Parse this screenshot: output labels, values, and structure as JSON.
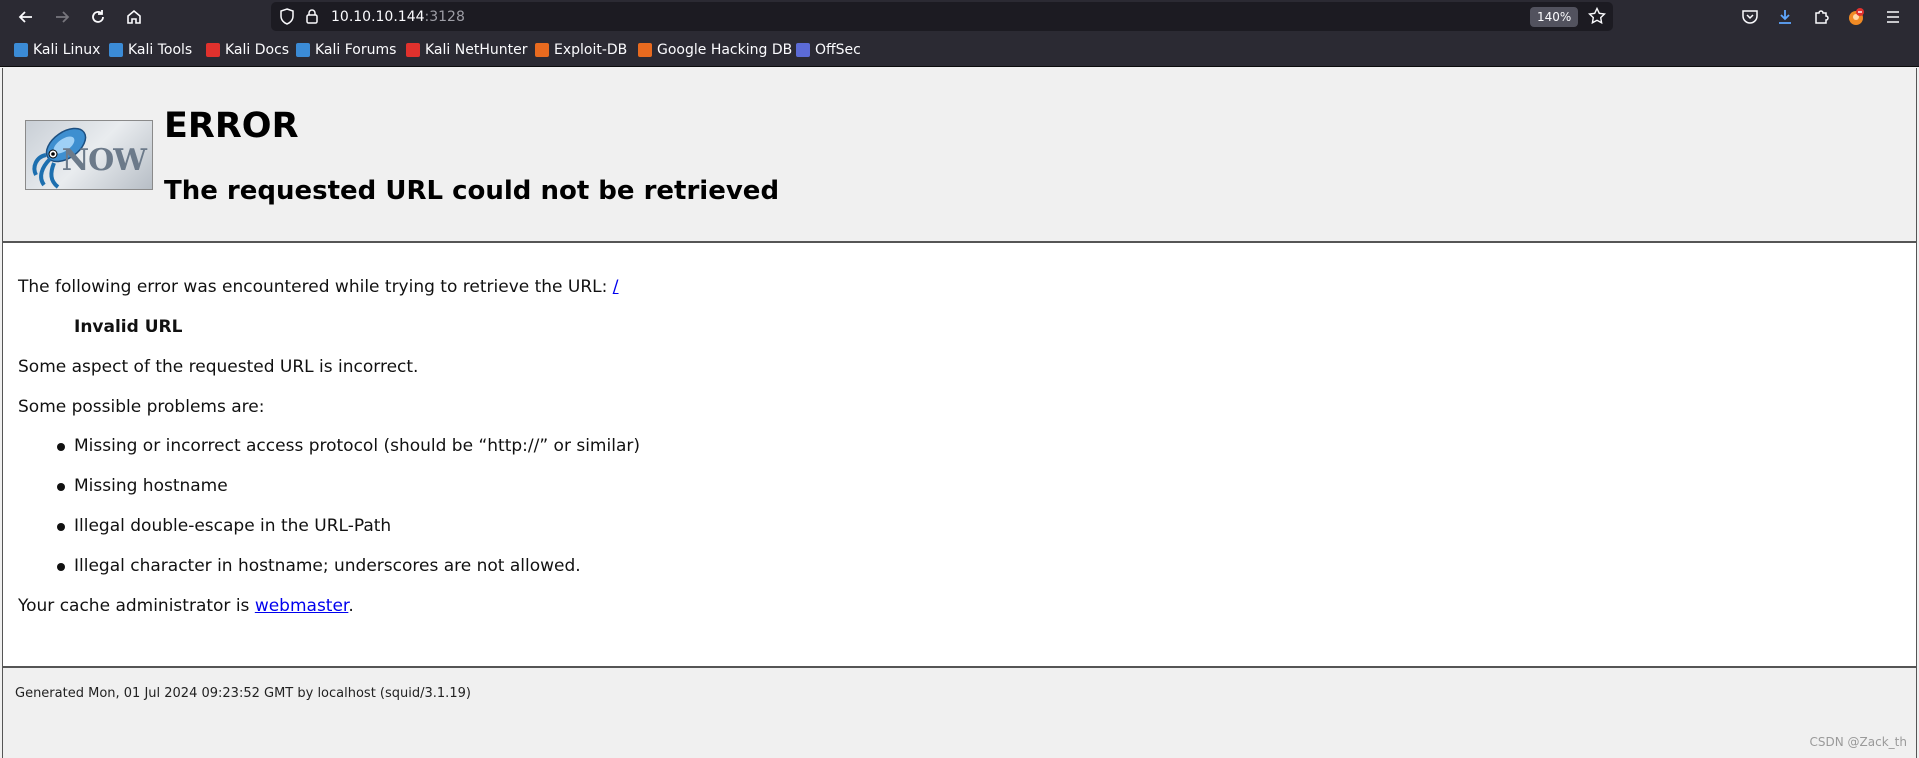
{
  "browser": {
    "url_host": "10.10.10.144",
    "url_port": ":3128",
    "zoom": "140%",
    "bookmarks": [
      {
        "label": "Kali Linux",
        "color": "#3b8bd6"
      },
      {
        "label": "Kali Tools",
        "color": "#3b8bd6"
      },
      {
        "label": "Kali Docs",
        "color": "#e0312d"
      },
      {
        "label": "Kali Forums",
        "color": "#3b8bd6"
      },
      {
        "label": "Kali NetHunter",
        "color": "#e0312d"
      },
      {
        "label": "Exploit-DB",
        "color": "#e86a1f"
      },
      {
        "label": "Google Hacking DB",
        "color": "#e86a1f"
      },
      {
        "label": "OffSec",
        "color": "#5c6bd6"
      }
    ]
  },
  "page": {
    "title": "ERROR",
    "subtitle": "The requested URL could not be retrieved",
    "intro": "The following error was encountered while trying to retrieve the URL: ",
    "url_link": "/",
    "error_name": "Invalid URL",
    "description": "Some aspect of the requested URL is incorrect.",
    "problems_intro": "Some possible problems are:",
    "problems": [
      "Missing or incorrect access protocol (should be “http://” or similar)",
      "Missing hostname",
      "Illegal double-escape in the URL-Path",
      "Illegal character in hostname; underscores are not allowed."
    ],
    "admin_prefix": "Your cache administrator is ",
    "admin_link": "webmaster",
    "admin_suffix": ".",
    "logo_text": "NOW",
    "footer": "Generated Mon, 01 Jul 2024 09:23:52 GMT by localhost (squid/3.1.19)"
  },
  "watermark": "CSDN @Zack_th"
}
